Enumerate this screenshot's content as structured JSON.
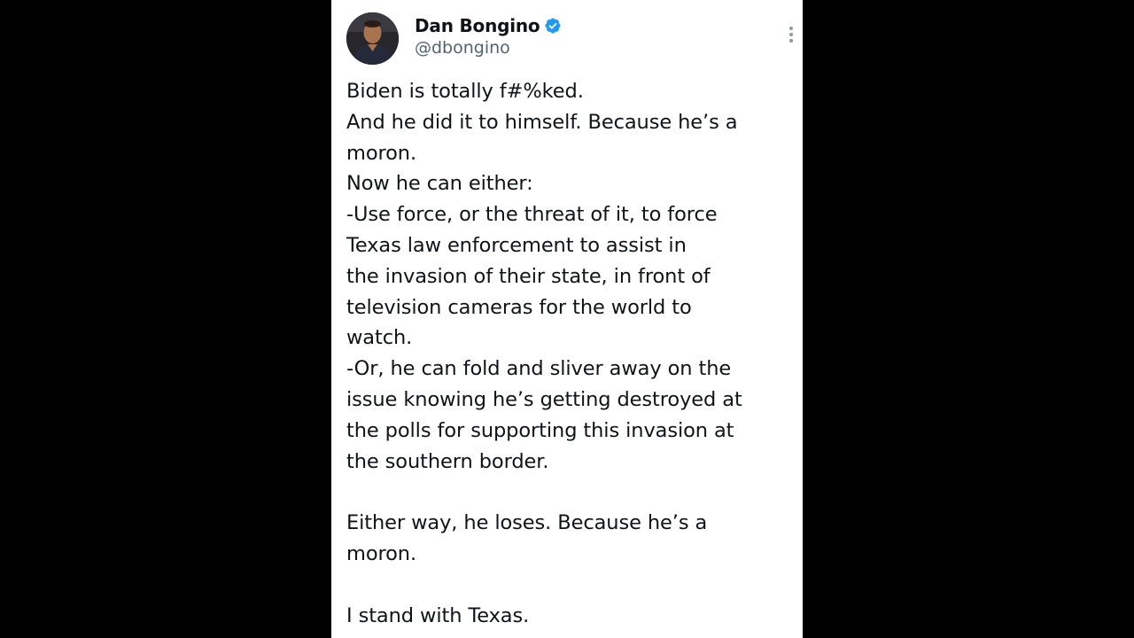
{
  "tweet": {
    "author": {
      "display_name": "Dan Bongino",
      "handle": "@dbongino",
      "verified": true,
      "verified_color": "#1d9bf0"
    },
    "more_icon": "more-vertical-icon",
    "text_lines": [
      "Biden is totally f#%ked.",
      "And he did it to himself. Because he’s a",
      "moron.",
      "Now he can either:",
      "-Use force, or the threat of it, to force",
      "Texas law enforcement to assist in",
      "the invasion of their state, in front of",
      "television cameras for the world to",
      "watch.",
      "-Or, he can fold and sliver away on the",
      "issue knowing he’s getting destroyed at",
      "the polls for supporting this invasion at",
      "the southern border.",
      "",
      "Either way, he loses. Because he’s a",
      "moron.",
      "",
      "I stand with Texas."
    ]
  },
  "colors": {
    "background": "#000000",
    "card": "#ffffff",
    "text_primary": "#0f1419",
    "text_secondary": "#536471"
  }
}
